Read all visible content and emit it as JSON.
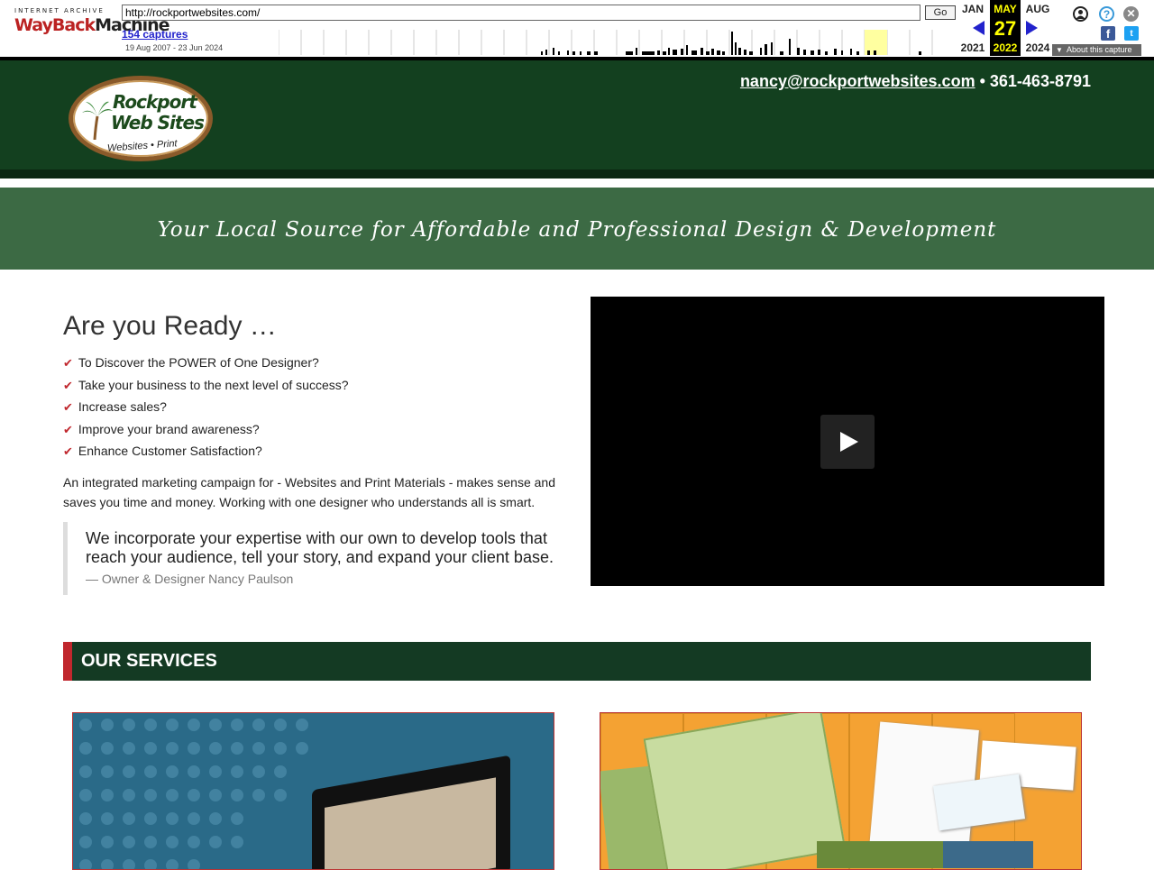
{
  "wayback": {
    "logo_top": "INTERNET ARCHIVE",
    "logo_wayback": "WayBack",
    "logo_machine": "Machine",
    "url": "http://rockportwebsites.com/",
    "go_label": "Go",
    "captures": "154 captures",
    "date_range": "19 Aug 2007 - 23 Jun 2024",
    "prev_month": "JAN",
    "prev_year": "2021",
    "cur_month": "MAY",
    "cur_day": "27",
    "cur_year": "2022",
    "next_month": "AUG",
    "next_year": "2024",
    "about_label": "About this capture"
  },
  "header": {
    "logo_line1": "Rockport",
    "logo_line2": "Web Sites",
    "logo_line3": "Websites • Print",
    "email": "nancy@rockportwebsites.com",
    "separator": " • ",
    "phone": "361-463-8791"
  },
  "tagline": "Your Local Source for Affordable and Professional Design & Development",
  "ready": {
    "heading": "Are you Ready …",
    "items": [
      "To Discover the POWER of One Designer?",
      "Take your business to the next level of success?",
      "Increase sales?",
      "Improve your brand awareness?",
      "Enhance Customer Satisfaction?"
    ],
    "intro": "An integrated marketing campaign for - Websites and Print Materials - makes sense and saves you time and money. Working with one designer who understands all is smart.",
    "quote": "We incorporate your expertise with our own to develop tools that reach your audience, tell your story, and expand your client base.",
    "cite": "— Owner & Designer Nancy Paulson"
  },
  "services": {
    "heading": "OUR SERVICES"
  },
  "colors": {
    "header_bg": "#13401f",
    "tagline_bg": "#3c6a44",
    "accent_red": "#c0272d"
  }
}
